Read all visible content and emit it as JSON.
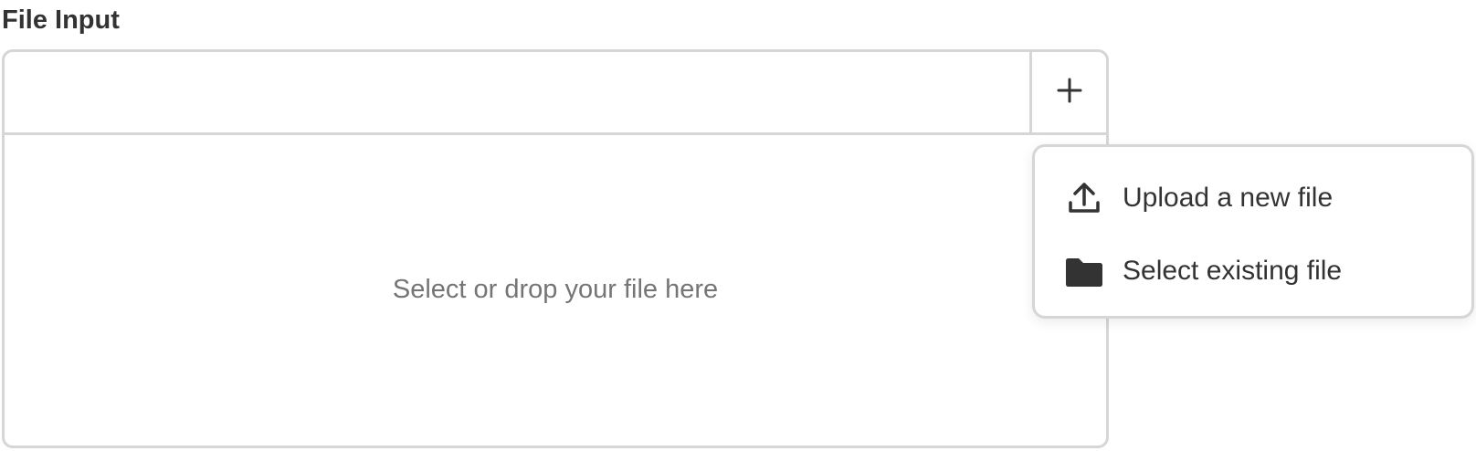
{
  "field": {
    "label": "File Input",
    "value": "",
    "dropzone_text": "Select or drop your file here"
  },
  "add_button": {
    "icon": "plus-icon"
  },
  "menu": {
    "items": [
      {
        "label": "Upload a new file",
        "icon": "upload-icon"
      },
      {
        "label": "Select existing file",
        "icon": "folder-icon"
      }
    ]
  },
  "colors": {
    "border": "#d6d6d6",
    "text": "#333333",
    "muted_text": "#757575",
    "icon": "#333333"
  }
}
